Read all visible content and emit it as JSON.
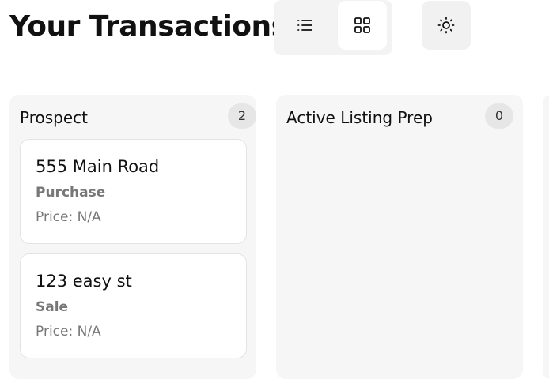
{
  "header": {
    "title": "Your Transactions",
    "view_toggle": {
      "list_icon": "list-icon",
      "grid_icon": "grid-icon",
      "selected": "grid"
    },
    "theme_icon": "sun-icon"
  },
  "columns": [
    {
      "title": "Prospect",
      "count": "2",
      "cards": [
        {
          "title": "555 Main Road",
          "type": "Purchase",
          "price": "Price: N/A"
        },
        {
          "title": "123 easy st",
          "type": "Sale",
          "price": "Price: N/A"
        }
      ]
    },
    {
      "title": "Active Listing Prep",
      "count": "0",
      "cards": []
    }
  ]
}
